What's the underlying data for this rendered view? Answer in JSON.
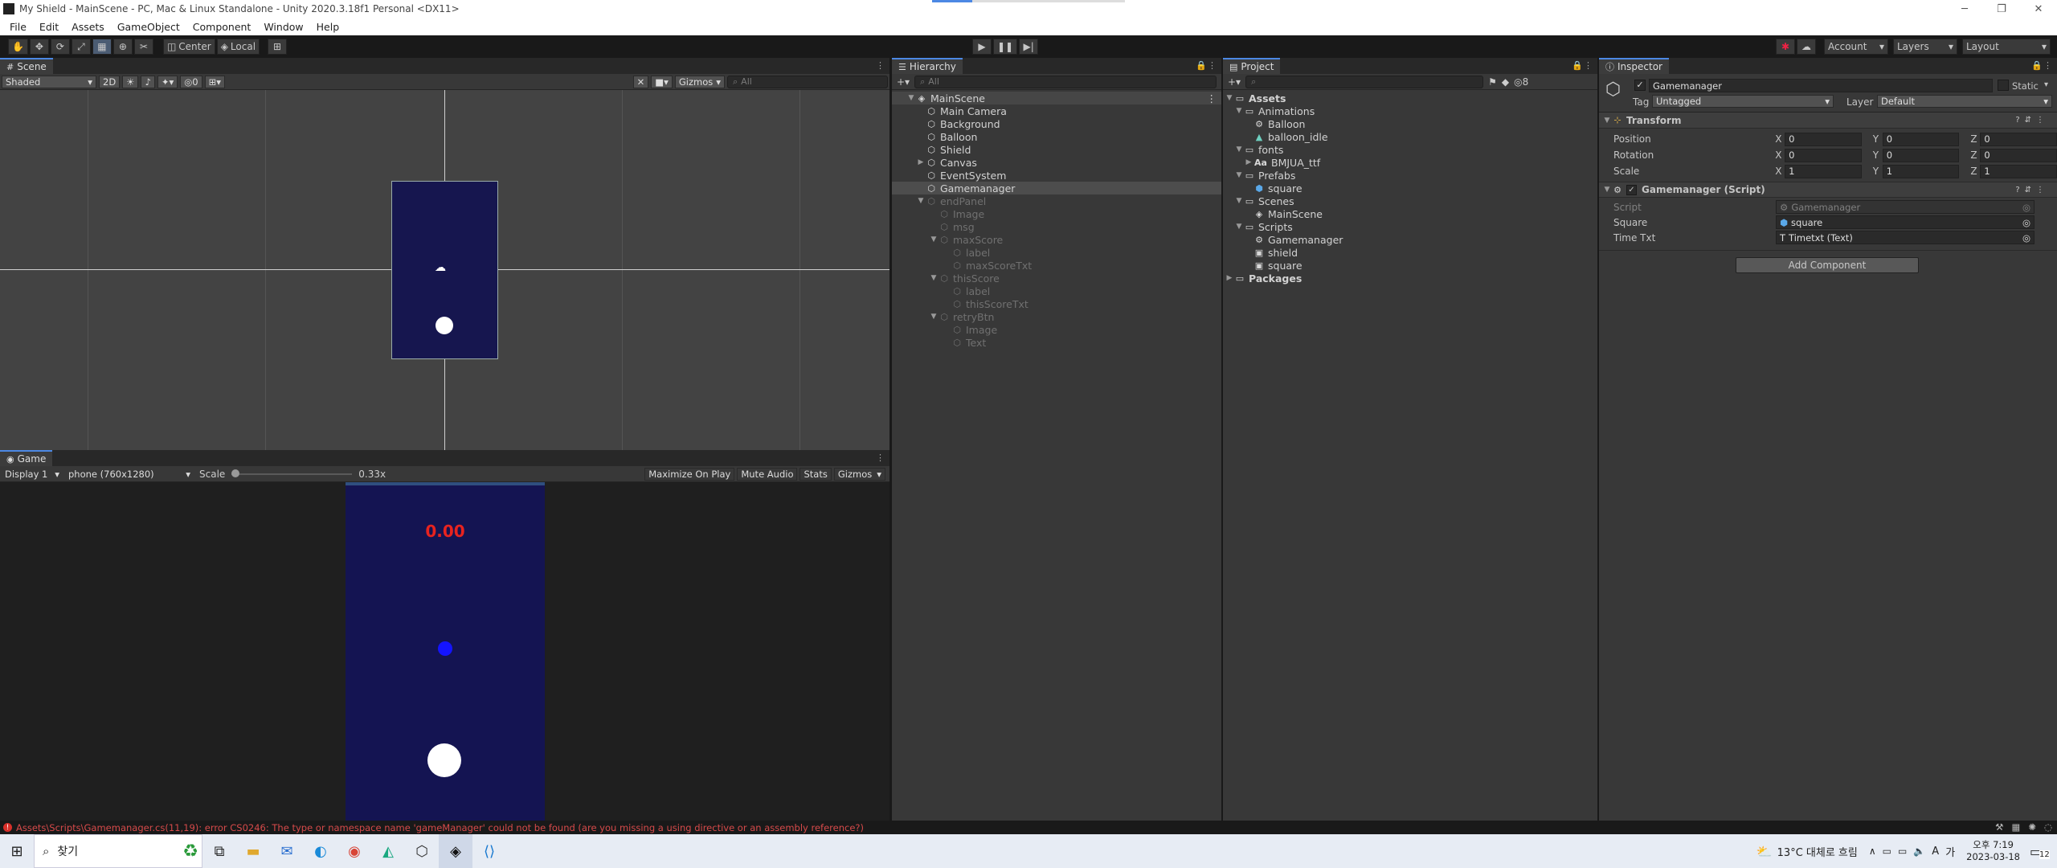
{
  "window": {
    "title": "My Shield - MainScene - PC, Mac & Linux Standalone - Unity 2020.3.18f1 Personal <DX11>"
  },
  "menu": [
    "File",
    "Edit",
    "Assets",
    "GameObject",
    "Component",
    "Window",
    "Help"
  ],
  "toolbar": {
    "pivot": "Center",
    "space": "Local",
    "account": "Account",
    "layers": "Layers",
    "layout": "Layout"
  },
  "scene": {
    "tab": "Scene",
    "draw_mode": "Shaded",
    "btn_2d": "2D",
    "hidden_count": "0",
    "gizmos": "Gizmos",
    "search_placeholder": "All"
  },
  "game": {
    "tab": "Game",
    "display": "Display 1",
    "resolution": "phone (760x1280)",
    "scale_label": "Scale",
    "scale_value": "0.33x",
    "maximize": "Maximize On Play",
    "mute": "Mute Audio",
    "stats": "Stats",
    "gizmos": "Gizmos",
    "timer_text": "0.00",
    "timer_color": "#e8231f",
    "bg_color": "#141452"
  },
  "hierarchy": {
    "tab": "Hierarchy",
    "search_placeholder": "All",
    "root": "MainScene",
    "items": [
      {
        "label": "Main Camera"
      },
      {
        "label": "Background"
      },
      {
        "label": "Balloon"
      },
      {
        "label": "Shield"
      },
      {
        "label": "Canvas"
      },
      {
        "label": "EventSystem"
      },
      {
        "label": "Gamemanager"
      },
      {
        "label": "endPanel"
      },
      {
        "label": "Image"
      },
      {
        "label": "msg"
      },
      {
        "label": "maxScore"
      },
      {
        "label": "label"
      },
      {
        "label": "maxScoreTxt"
      },
      {
        "label": "thisScore"
      },
      {
        "label": "label"
      },
      {
        "label": "thisScoreTxt"
      },
      {
        "label": "retryBtn"
      },
      {
        "label": "Image"
      },
      {
        "label": "Text"
      }
    ]
  },
  "project": {
    "tab": "Project",
    "hidden_count": "8",
    "items": [
      {
        "label": "Assets"
      },
      {
        "label": "Animations"
      },
      {
        "label": "Balloon"
      },
      {
        "label": "balloon_idle"
      },
      {
        "label": "fonts"
      },
      {
        "label": "BMJUA_ttf"
      },
      {
        "label": "Prefabs"
      },
      {
        "label": "square"
      },
      {
        "label": "Scenes"
      },
      {
        "label": "MainScene"
      },
      {
        "label": "Scripts"
      },
      {
        "label": "Gamemanager"
      },
      {
        "label": "shield"
      },
      {
        "label": "square"
      },
      {
        "label": "Packages"
      }
    ]
  },
  "inspector": {
    "tab": "Inspector",
    "object_name": "Gamemanager",
    "static_label": "Static",
    "tag_label": "Tag",
    "tag_value": "Untagged",
    "layer_label": "Layer",
    "layer_value": "Default",
    "transform": {
      "title": "Transform",
      "rows": [
        {
          "label": "Position",
          "x": "0",
          "y": "0",
          "z": "0"
        },
        {
          "label": "Rotation",
          "x": "0",
          "y": "0",
          "z": "0"
        },
        {
          "label": "Scale",
          "x": "1",
          "y": "1",
          "z": "1"
        }
      ]
    },
    "script": {
      "title": "Gamemanager (Script)",
      "rows": [
        {
          "label": "Script",
          "value": "Gamemanager"
        },
        {
          "label": "Square",
          "value": "square"
        },
        {
          "label": "Time Txt",
          "value": "Timetxt (Text)"
        }
      ]
    },
    "add_component": "Add Component"
  },
  "status": {
    "error": "Assets\\Scripts\\Gamemanager.cs(11,19): error CS0246: The type or namespace name 'gameManager' could not be found (are you missing a using directive or an assembly reference?)"
  },
  "taskbar": {
    "search_text": "찾기",
    "weather": "13°C 대체로 흐림",
    "ime": "A",
    "ime2": "가",
    "time": "오후 7:19",
    "date": "2023-03-18",
    "notifications": "12"
  }
}
